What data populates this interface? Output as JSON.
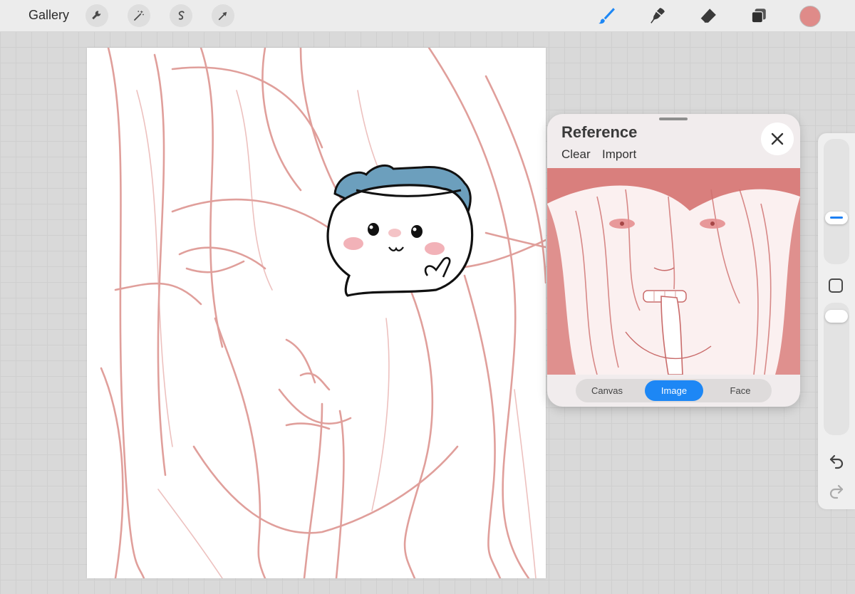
{
  "topbar": {
    "gallery_label": "Gallery",
    "left_tools": [
      "wrench-icon",
      "magic-wand-icon",
      "selection-s-icon",
      "transform-arrow-icon"
    ],
    "right_tools": [
      "brush-icon",
      "smudge-icon",
      "eraser-icon",
      "layers-icon"
    ],
    "active_tool": "brush-icon",
    "current_color": "#df8b89"
  },
  "colors": {
    "accent": "#1d87f5",
    "sketch_line": "#d98883"
  },
  "reference_panel": {
    "title": "Reference",
    "clear_label": "Clear",
    "import_label": "Import",
    "tabs": [
      "Canvas",
      "Image",
      "Face"
    ],
    "selected_tab": "Image"
  },
  "sidebar": {
    "brush_size_level": 0.35,
    "opacity_level": 0.95,
    "icons": [
      "undo-icon",
      "redo-icon"
    ]
  }
}
